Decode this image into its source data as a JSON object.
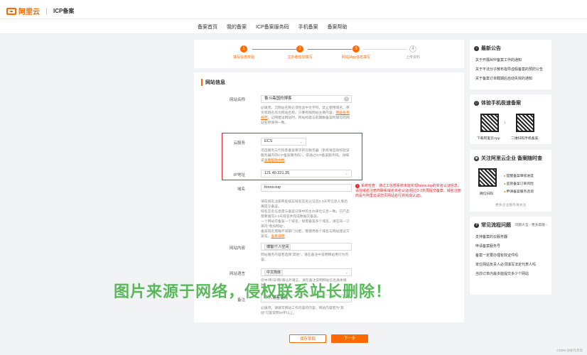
{
  "header": {
    "logo": "阿里云",
    "product": "ICP备案"
  },
  "nav": [
    "备案首页",
    "我的备案",
    "ICP备案服务码",
    "手机备案",
    "备案帮助"
  ],
  "steps": [
    {
      "n": "1",
      "label": "填写信息校验",
      "active": true
    },
    {
      "n": "2",
      "label": "主办者信息填写",
      "active": true
    },
    {
      "n": "3",
      "label": "网站/App信息填写",
      "active": true
    },
    {
      "n": "4",
      "label": "上传资料",
      "active": false
    }
  ],
  "form": {
    "section": "网站信息",
    "site_name": {
      "label": "网站名称",
      "value": "鲁斗斋国的博客",
      "help": "必填项。沉网站名称必须包含中文字符，禁止使用域名、英文或域名作为网站名称。只要有限网站主要内容，",
      "help_link": "网站名称规范",
      "help2": "。记网建设网站时，网站标题与前期跟备案时填写的网站名称保持一致。"
    },
    "cloud": {
      "label": "云服务",
      "value": "ECS",
      "help": "可选服务与代码套备案要求的云服务器（系统将自动校验该服务器内的ICP备案服务码），或通过ICP备案服务码。详细说",
      "help_link": "查看帮助文档"
    },
    "ip": {
      "label": "IP地址",
      "value": "121.40.221.35"
    },
    "domain": {
      "label": "域名",
      "value": "fonno.top",
      "help": "请在域名注册商处核实域名实名认证且3-3天传信息人库后再提交备案。\n域名实名信息需与备案订单中的主办单位信息一致，已产品需要填写2-3天域名并完成数据交备案。\n一个网站可备案一个域名，如需备案多个域名，请在同一订单内\"增加网站\"。\n备案域名需确不同部门分配，需使用各个域名与网站建议方案号。",
      "help_link": "查看说明"
    },
    "error": "系统检查：通过工信部系统未能实现fonno.top的实名认证信息，请在域名注册商联系域名实名认证(经过2-3天再提交备案。域名注册商是与阿里云请您页网站名行并完成认证)。",
    "content": {
      "label": "网站内容",
      "tag": "博客/个人空间",
      "help": "网站服务内容若选择\"其他\"，请在备注中说明网站用行为内容。"
    },
    "language": {
      "label": "网站语言",
      "tag": "中文简体",
      "help": "仅中/英/日/韩/语以外语言，请在备注说明网站信息具体语种。"
    },
    "remark": {
      "label": "备注",
      "value": "个人博客使用",
      "help": "必填项。请填写网站工作内容的内容，网站内容若为\"其他\"可里说明20字以上。"
    }
  },
  "buttons": {
    "draft": "保存草稿",
    "next": "下一步"
  },
  "side": {
    "announce_title": "最新公告",
    "announcements": [
      "关于开展APP备案工作的通知",
      "关于不法分子散布指导虚假备案的预防公告",
      "关于备案订单截期后自动失效的通知"
    ],
    "mobile_title": "体验手机极速备案",
    "qr1": "下载阿里云App",
    "qr2": "二维扫码手机备案",
    "follow_title": "关注阿里云企业 备案随时查",
    "follow_qr": "微信扫码",
    "follow_feats": [
      "提醒备案审核进度",
      "监管备案订单风险",
      "申请备案服务咨询"
    ],
    "follow_more": "更多企业服务请关注",
    "faq_title": "常见流程问题",
    "faq_more": "问题大全 › 更多帮助 ›",
    "faqs": [
      "支持备案的云服务器",
      "申请备案服务号",
      "备案一定要办理有效证件吗",
      "单位网站负责人必须填写法定代表人吗",
      "当前订单内最多能提交多少个网站"
    ]
  },
  "watermark": "图片来源于网络，侵权联系站长删除！",
  "footer": "CSDN @亦凡华华"
}
